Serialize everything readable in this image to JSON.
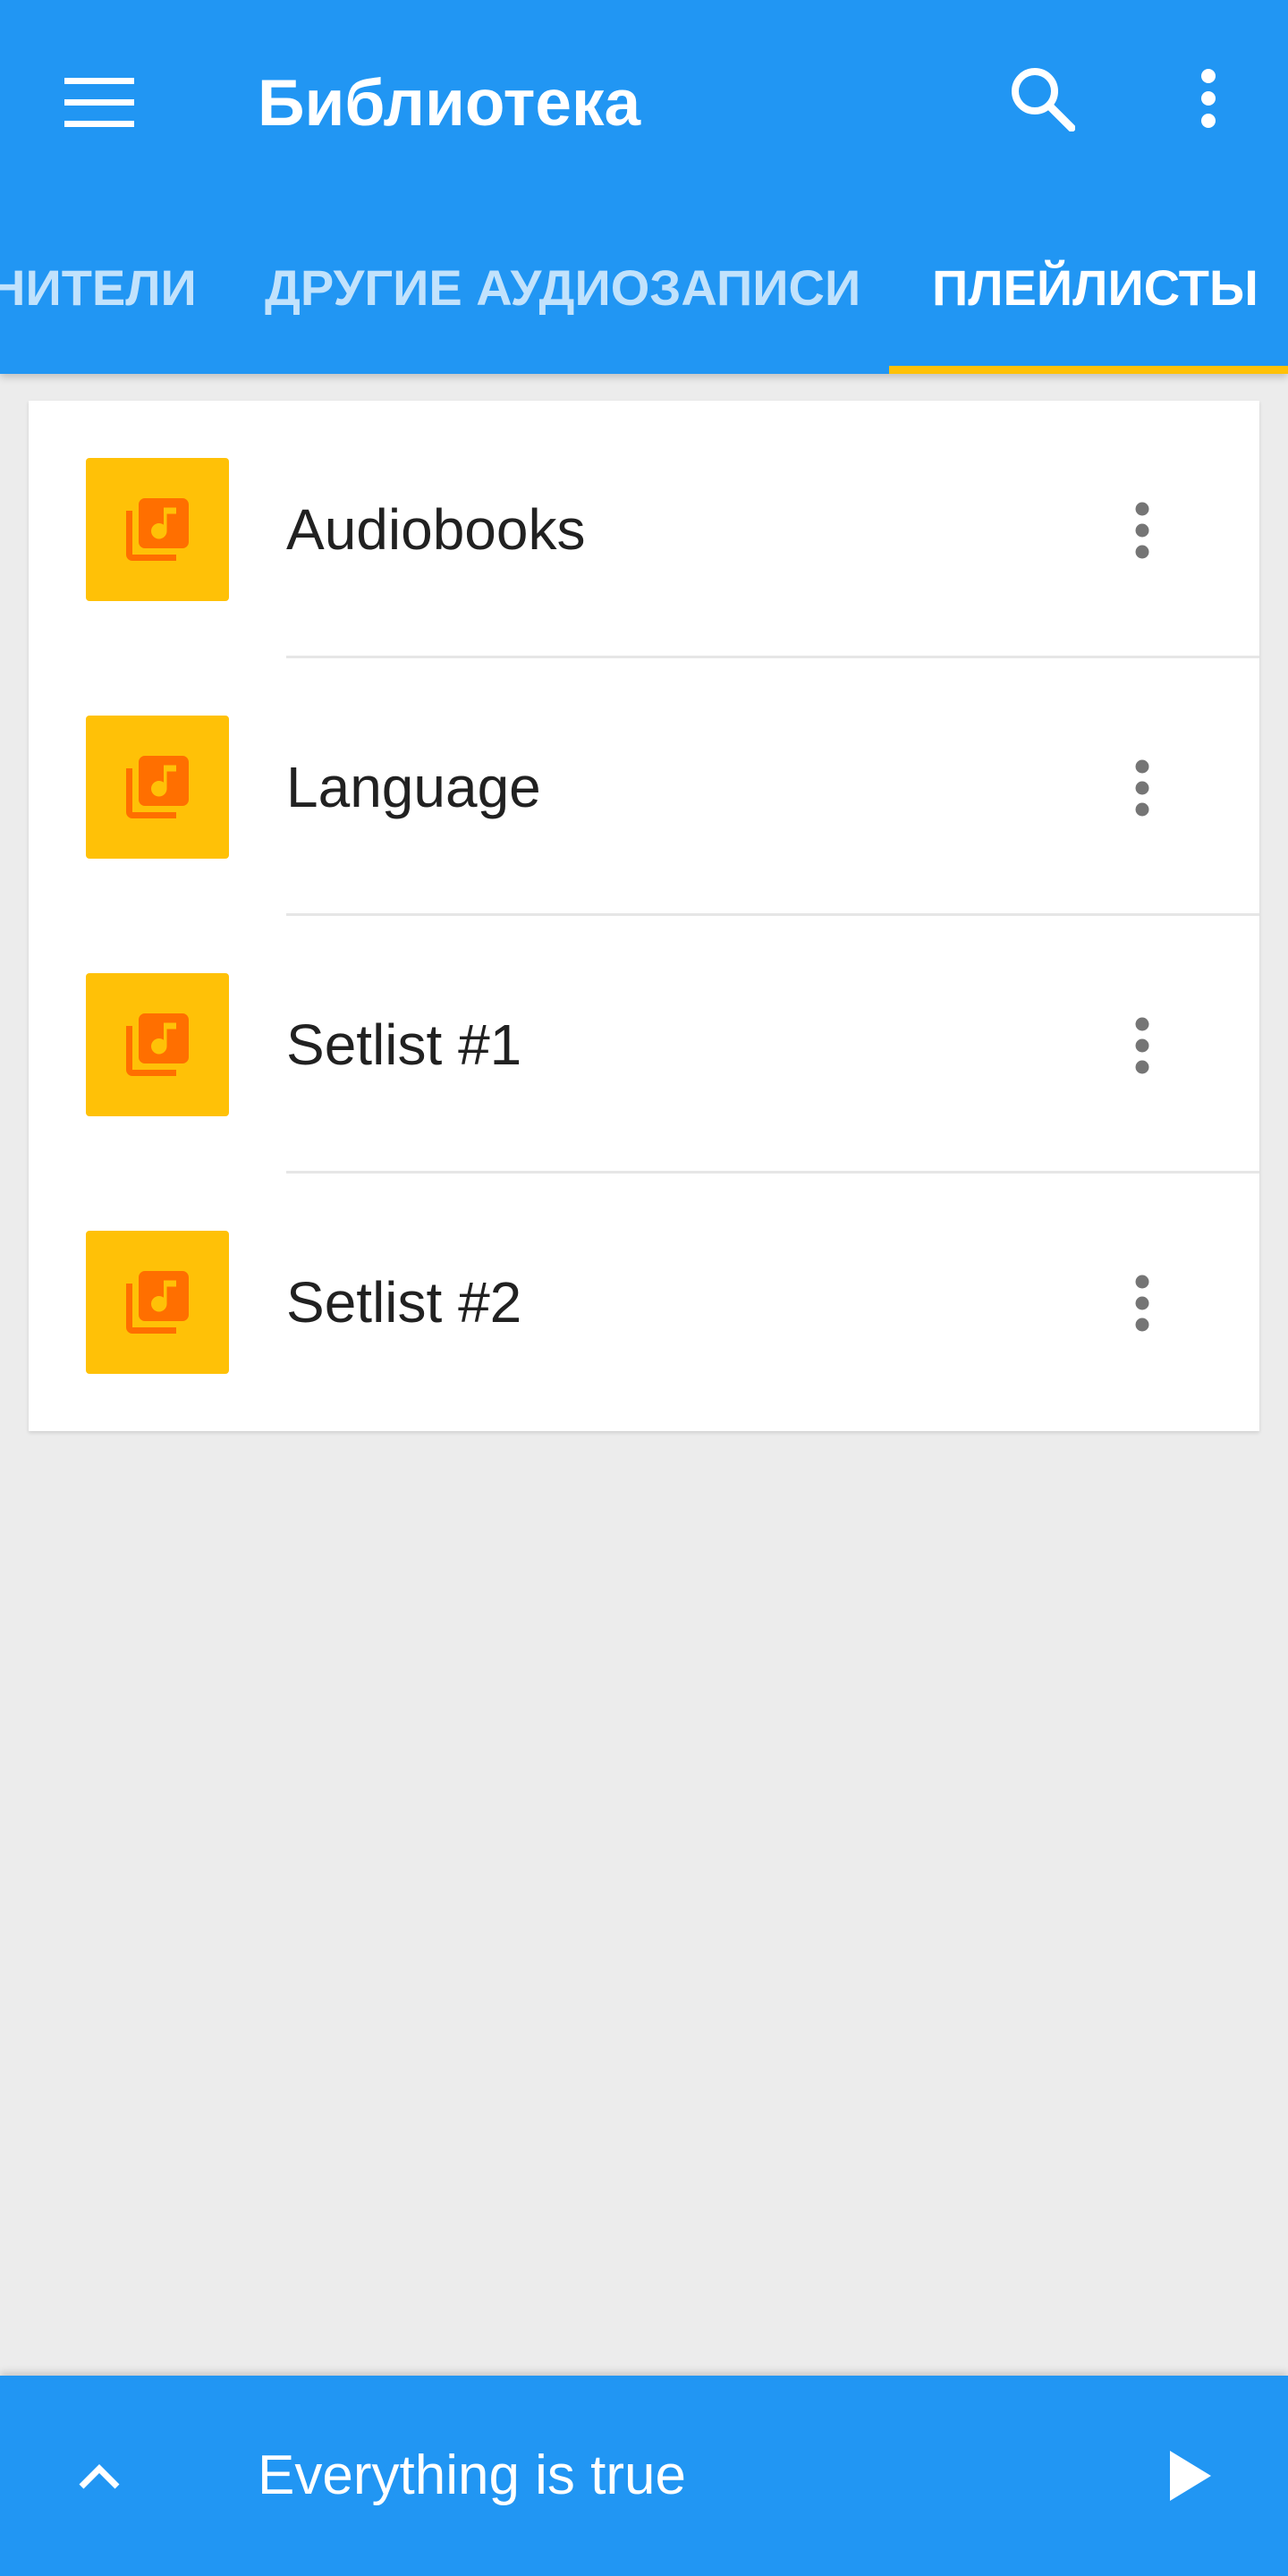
{
  "app": {
    "title": "Библиотека"
  },
  "toolbar": {
    "menu_icon": "hamburger-menu-icon",
    "search_icon": "search-icon",
    "overflow_icon": "more-vertical-icon"
  },
  "tabs": [
    {
      "label": "НИТЕЛИ",
      "selected": false
    },
    {
      "label": "ДРУГИЕ АУДИОЗАПИСИ",
      "selected": false
    },
    {
      "label": "ПЛЕЙЛИСТЫ",
      "selected": true
    }
  ],
  "playlists": [
    {
      "name": "Audiobooks",
      "icon": "playlist-music-icon"
    },
    {
      "name": "Language",
      "icon": "playlist-music-icon"
    },
    {
      "name": "Setlist #1",
      "icon": "playlist-music-icon"
    },
    {
      "name": "Setlist #2",
      "icon": "playlist-music-icon"
    }
  ],
  "player": {
    "track_title": "Everything is true",
    "expand_icon": "chevron-up-icon",
    "play_icon": "play-icon"
  },
  "colors": {
    "primary": "#2196f3",
    "accent": "#ffc107",
    "playlist_icon": "#ff6f00",
    "background": "#ececec"
  }
}
